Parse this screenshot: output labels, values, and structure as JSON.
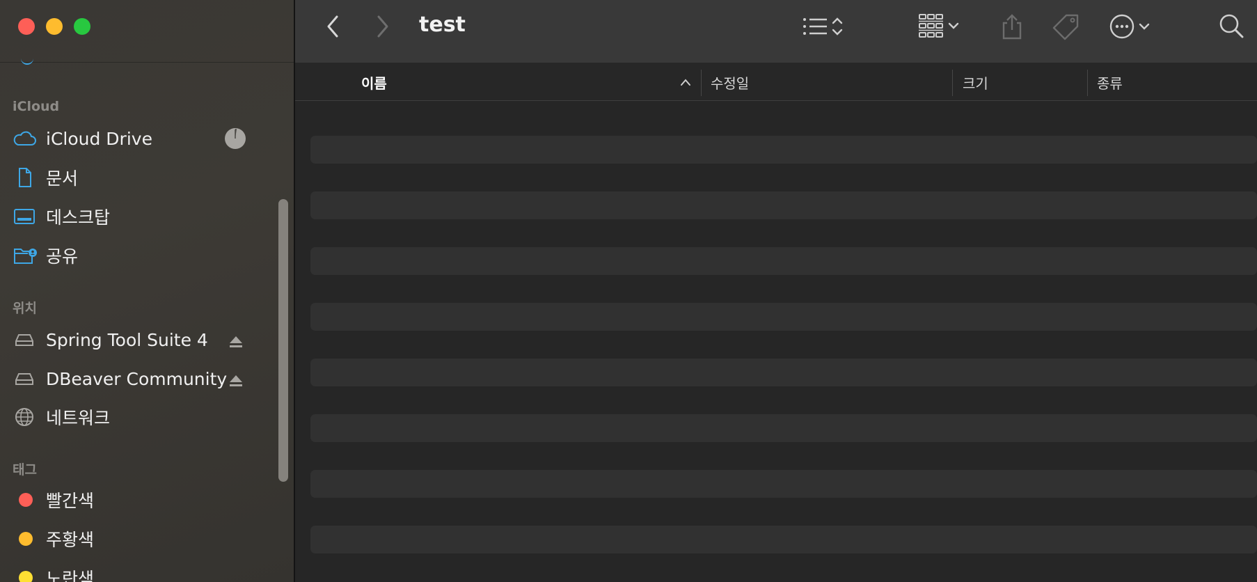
{
  "window": {
    "title": "test"
  },
  "sidebar": {
    "sections": [
      {
        "header": "iCloud",
        "items": [
          {
            "label": "iCloud Drive",
            "icon": "cloud-icon"
          },
          {
            "label": "문서",
            "icon": "document-icon"
          },
          {
            "label": "데스크탑",
            "icon": "desktop-icon"
          },
          {
            "label": "공유",
            "icon": "shared-folder-icon"
          }
        ]
      },
      {
        "header": "위치",
        "items": [
          {
            "label": "Spring Tool Suite 4",
            "icon": "disk-icon"
          },
          {
            "label": "DBeaver Community",
            "icon": "disk-icon"
          },
          {
            "label": "네트워크",
            "icon": "network-icon"
          }
        ]
      },
      {
        "header": "태그",
        "items": [
          {
            "label": "빨간색",
            "color": "#fe5f57"
          },
          {
            "label": "주황색",
            "color": "#febc2e"
          },
          {
            "label": "노란색",
            "color": "#ffe033"
          }
        ]
      }
    ]
  },
  "columns": {
    "name": "이름",
    "modified": "수정일",
    "size": "크기",
    "kind": "종류"
  },
  "colors": {
    "accent": "#3ea7e6",
    "close": "#fe5f57",
    "minimize": "#febc2e",
    "maximize": "#28c840"
  }
}
